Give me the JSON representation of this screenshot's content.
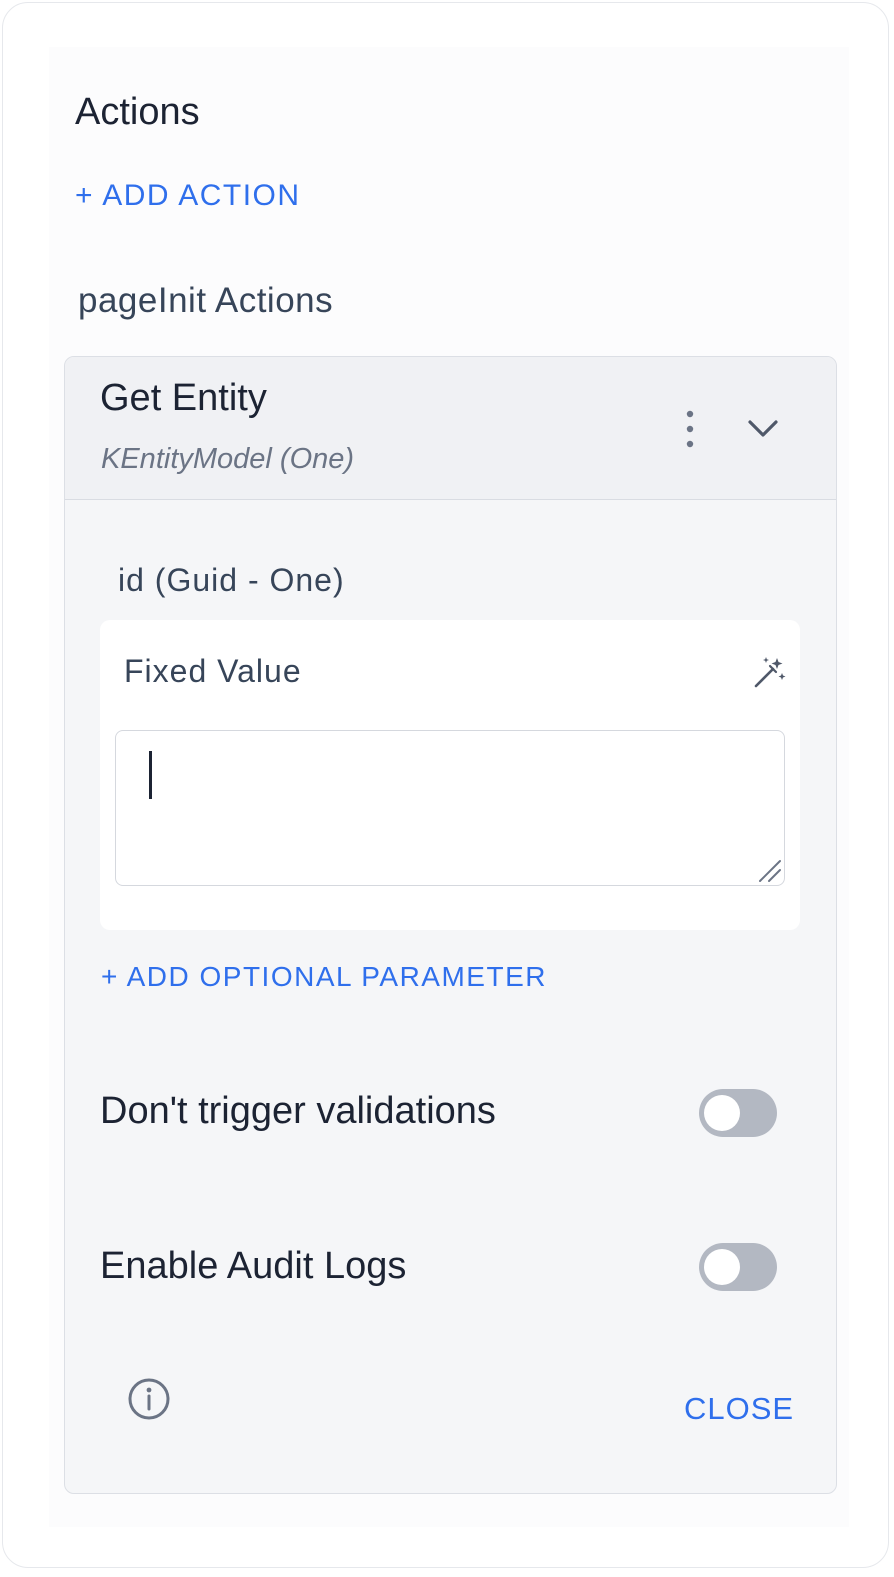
{
  "panel": {
    "title": "Actions",
    "add_action_label": "+ ADD ACTION",
    "section_label": "pageInit Actions"
  },
  "action_card": {
    "title": "Get Entity",
    "subtitle": "KEntityModel (One)",
    "icons": {
      "menu": "more-vertical-icon",
      "expand": "chevron-down-icon"
    },
    "parameter": {
      "label": "id (Guid - One)",
      "value_type": "Fixed Value",
      "value": "",
      "icon": "magic-wand-icon"
    },
    "add_optional_label": "+ ADD OPTIONAL PARAMETER",
    "toggles": [
      {
        "label": "Don't trigger validations",
        "on": false
      },
      {
        "label": "Enable Audit Logs",
        "on": false
      }
    ],
    "footer": {
      "info_icon": "info-icon",
      "close_label": "CLOSE"
    }
  },
  "colors": {
    "accent": "#2f6fec",
    "text_primary": "#1c2333",
    "text_secondary": "#374559",
    "card_bg": "#f5f6f8",
    "toggle_off": "#b3b8c2"
  }
}
